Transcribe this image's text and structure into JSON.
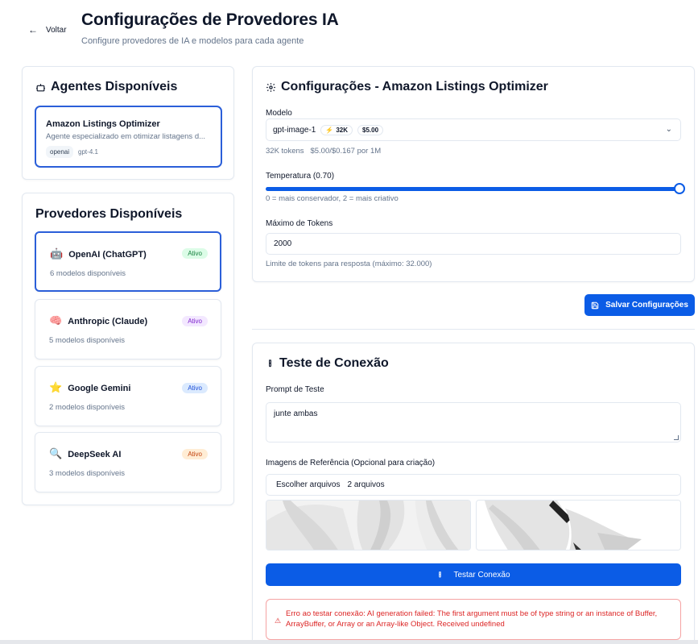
{
  "header": {
    "back_label": "Voltar",
    "title": "Configurações de Provedores IA",
    "subtitle": "Configure provedores de IA e modelos para cada agente"
  },
  "agents": {
    "title": "Agentes Disponíveis",
    "items": [
      {
        "name": "Amazon Listings Optimizer",
        "description": "Agente especializado em otimizar listagens d...",
        "provider": "openai",
        "model": "gpt-4.1"
      }
    ]
  },
  "providers": {
    "title": "Provedores Disponíveis",
    "items": [
      {
        "icon": "🤖",
        "name": "OpenAI (ChatGPT)",
        "status": "Ativo",
        "count": "6 modelos disponíveis",
        "badge_bg": "#dcfce7",
        "badge_fg": "#15803d"
      },
      {
        "icon": "🧠",
        "name": "Anthropic (Claude)",
        "status": "Ativo",
        "count": "5 modelos disponíveis",
        "badge_bg": "#f3e8ff",
        "badge_fg": "#7e22ce"
      },
      {
        "icon": "⭐",
        "name": "Google Gemini",
        "status": "Ativo",
        "count": "2 modelos disponíveis",
        "badge_bg": "#dbeafe",
        "badge_fg": "#1d4ed8"
      },
      {
        "icon": "🔍",
        "name": "DeepSeek AI",
        "status": "Ativo",
        "count": "3 modelos disponíveis",
        "badge_bg": "#ffedd5",
        "badge_fg": "#c2410c"
      }
    ]
  },
  "config": {
    "title": "Configurações - Amazon Listings Optimizer",
    "model_label": "Modelo",
    "model_value": "gpt-image-1",
    "model_tokens_chip": "32K",
    "model_price_chip": "$5.00",
    "model_info_tokens": "32K tokens",
    "model_info_price": "$5.00/$0.167 por 1M",
    "temperature_label": "Temperatura (0.70)",
    "temperature_value": 0.7,
    "temperature_max": 2,
    "temperature_help": "0 = mais conservador, 2 = mais criativo",
    "max_tokens_label": "Máximo de Tokens",
    "max_tokens_value": "2000",
    "max_tokens_help": "Limite de tokens para resposta (máximo: 32.000)",
    "save_label": "Salvar Configurações"
  },
  "test": {
    "title": "Teste de Conexão",
    "prompt_label": "Prompt de Teste",
    "prompt_value": "junte ambas",
    "images_label": "Imagens de Referência (Opcional para criação)",
    "choose_files_label": "Escolher arquivos",
    "files_status": "2 arquivos",
    "test_button_label": "Testar Conexão",
    "error_text": "Erro ao testar conexão: AI generation failed: The first argument must be of type string or an instance of Buffer, ArrayBuffer, or Array or an Array-like Object. Received undefined"
  },
  "colors": {
    "accent": "#0b5ce6",
    "selected_border": "#2b5fd9",
    "error": "#dc2626"
  }
}
